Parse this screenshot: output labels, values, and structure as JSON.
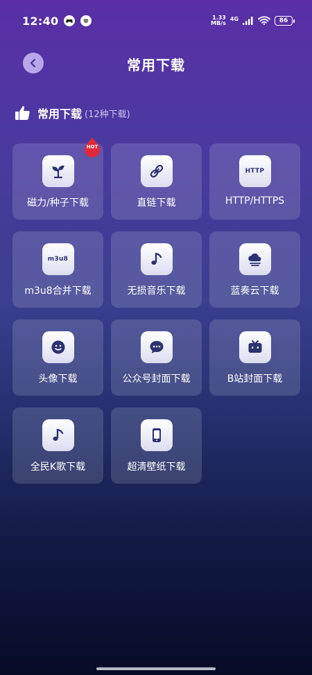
{
  "status_bar": {
    "time": "12:40",
    "net_speed_value": "1.33",
    "net_speed_unit": "MB/s",
    "net_type": "4G",
    "battery": "86"
  },
  "header": {
    "title": "常用下载"
  },
  "section": {
    "title": "常用下载",
    "count": "(12种下载)"
  },
  "badge": {
    "hot": "HOT"
  },
  "tiles": [
    {
      "label": "磁力/种子下载",
      "icon": "sprout-icon"
    },
    {
      "label": "直链下载",
      "icon": "link-icon"
    },
    {
      "label": "HTTP/HTTPS",
      "icon": "http-icon",
      "icon_text": "HTTP"
    },
    {
      "label": "m3u8合并下载",
      "icon": "m3u8-icon",
      "icon_text": "m3u8"
    },
    {
      "label": "无损音乐下载",
      "icon": "music-note-icon"
    },
    {
      "label": "蓝奏云下载",
      "icon": "cloud-icon"
    },
    {
      "label": "头像下载",
      "icon": "smiley-icon"
    },
    {
      "label": "公众号封面下载",
      "icon": "chat-bubble-icon"
    },
    {
      "label": "B站封面下载",
      "icon": "tv-icon"
    },
    {
      "label": "全民K歌下载",
      "icon": "music-note-icon"
    },
    {
      "label": "超清壁纸下载",
      "icon": "phone-icon"
    }
  ],
  "colors": {
    "bg_top": "#5a2fa6",
    "bg_bottom": "#070b26",
    "icon_fg": "#2d3270",
    "back_button": "#b8a6ea",
    "hot_badge": "#e0283c"
  }
}
